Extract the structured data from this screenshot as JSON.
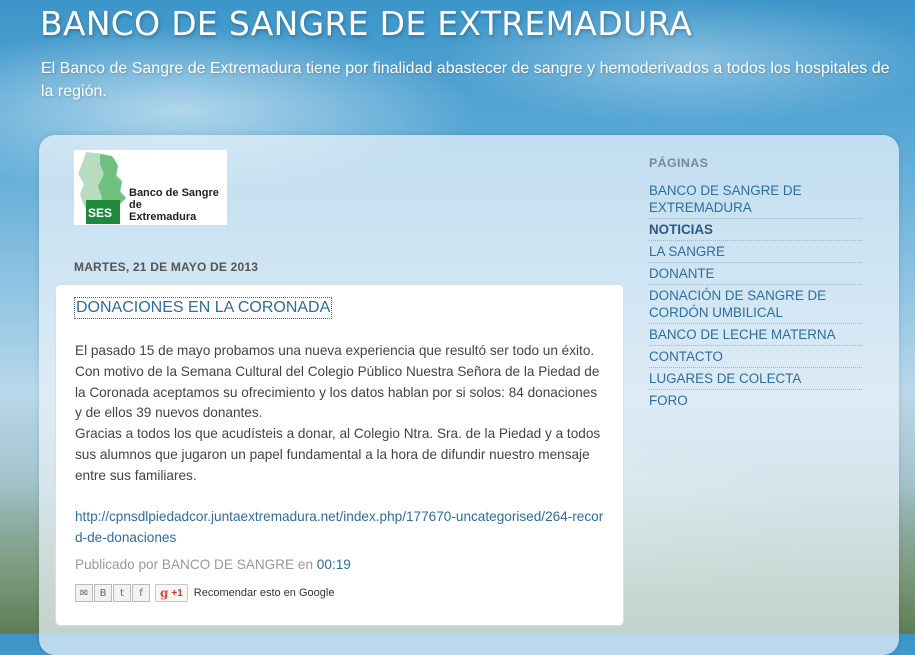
{
  "header": {
    "title": "BANCO DE SANGRE DE EXTREMADURA",
    "description": "El Banco de Sangre de Extremadura tiene por finalidad abastecer de sangre y hemoderivados a todos los hospitales de la región."
  },
  "logo": {
    "line1": "Banco de Sangre",
    "line2": "de",
    "line3": "Extremadura",
    "badge": "SES"
  },
  "post": {
    "date": "MARTES, 21 DE MAYO DE 2013",
    "title": "DONACIONES EN LA CORONADA",
    "paragraph1": "El pasado 15 de mayo probamos una nueva experiencia que resultó ser todo un éxito. Con motivo de la Semana Cultural del Colegio Público Nuestra Señora de la Piedad de la Coronada aceptamos su ofrecimiento y los datos hablan por si solos: 84 donaciones y de ellos 39 nuevos donantes.",
    "paragraph2": "Gracias a todos los que acudísteis a donar, al Colegio Ntra. Sra. de la Piedad y a todos sus alumnos que jugaron un papel fundamental a la hora de difundir nuestro mensaje entre sus familiares.",
    "link": "http://cpnsdlpiedadcor.juntaextremadura.net/index.php/177670-uncategorised/264-record-de-donaciones",
    "published_by": "Publicado por",
    "author": "BANCO DE SANGRE",
    "at": "en",
    "time": "00:19",
    "plusone": "+1",
    "recommend": "Recomendar esto en Google"
  },
  "sidebar": {
    "title": "PÁGINAS",
    "pages": [
      {
        "label": "BANCO DE SANGRE DE EXTREMADURA"
      },
      {
        "label": "NOTICIAS"
      },
      {
        "label": "LA SANGRE"
      },
      {
        "label": "DONANTE"
      },
      {
        "label": "DONACIÓN DE SANGRE DE CORDÓN UMBILICAL"
      },
      {
        "label": "BANCO DE LECHE MATERNA"
      },
      {
        "label": "CONTACTO"
      },
      {
        "label": "LUGARES DE COLECTA"
      },
      {
        "label": "FORO"
      }
    ]
  },
  "colors": {
    "link": "#2d6e9d",
    "logo_green": "#1e8a3c"
  }
}
